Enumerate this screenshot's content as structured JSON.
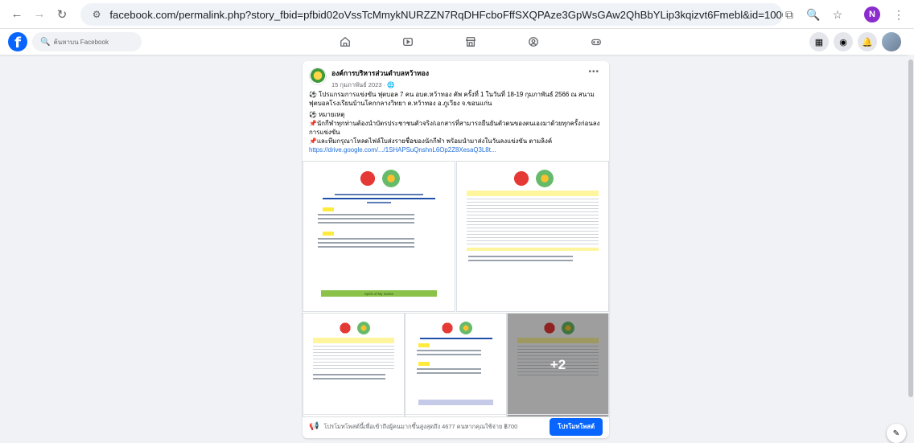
{
  "browser": {
    "url": "facebook.com/permalink.php?story_fbid=pfbid02oVssTcMmykNURZZN7RqDHFcboFffSXQPAze3GpWsGAw2QhBbYLip3kqizvt6Fmebl&id=100057443259211",
    "profile_initial": "N"
  },
  "fb": {
    "search_placeholder": "ค้นหาบน Facebook"
  },
  "post": {
    "page_name": "องค์การบริหารส่วนตำบลหว้าทอง",
    "date": "15 กุมภาพันธ์ 2023 · ",
    "text1": "⚽ โปรแกรมการแข่งขัน ฟุตบอล 7 คน อบต.หว้าทอง คัพ ครั้งที่ 1 ในวันที่ 18-19 กุมภาพันธ์ 2566 ณ สนามฟุตบอลโรงเรียนบ้านโคกกลางวิทยา ต.หว้าทอง อ.ภูเวียง จ.ขอนแก่น",
    "text2": "⚽ หมายเหตุ",
    "text3": "📌นักกีฬาทุกท่านต้องนำบัตรประชาชนตัวจริง/เอกสารที่สามารถยืนยันตัวตนของตนเองมาด้วยทุกครั้งก่อนลงการแข่งขัน",
    "text4": "📌และทีมกรุณาโหลดไฟล์ใบส่งรายชื่อของนักกีฬา พร้อมนำมาส่งในวันลงแข่งขัน ตามลิงค์",
    "link": "https://drive.google.com/.../1SHAPSuQnshnL6Op2Z8XesaQ3L8t...",
    "more_photos": "+2",
    "poster_footer": "Spirit of My Game",
    "boost_text": "โปรโมทโพสต์นี้เพื่อเข้าถึงผู้คนมากขึ้นสูงสุดถึง 4677 คนหากคุณใช้จ่าย ฿700",
    "boost_button": "โปรโมทโพสต์"
  }
}
